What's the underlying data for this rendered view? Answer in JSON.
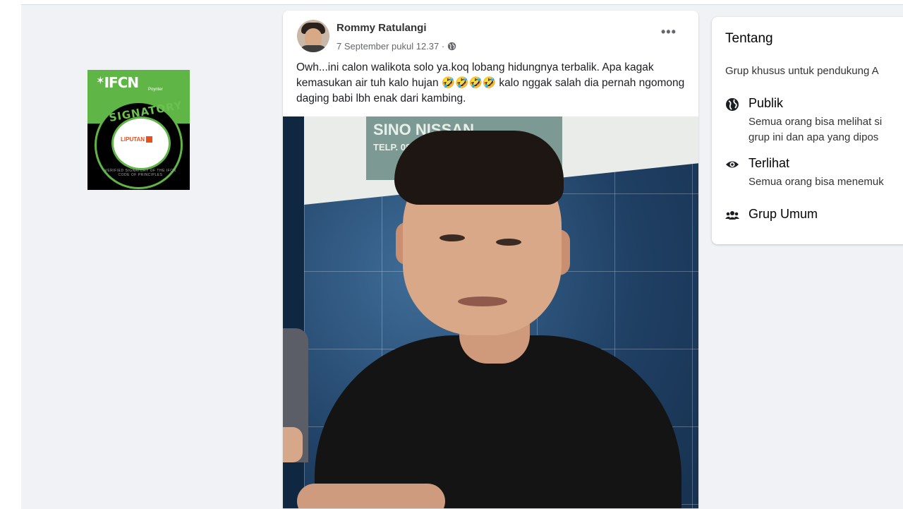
{
  "badge": {
    "logo": "IFCN",
    "logo_sub": "Poynter",
    "ring_text": "SIGNATORY",
    "ring_small": "VERIFIED SIGNATORY OF THE IFCN CODE OF PRINCIPLES",
    "publisher": "LIPUTAN"
  },
  "post": {
    "author": "Rommy Ratulangi",
    "timestamp": "7 September pukul 12.37 ·",
    "more_label": "•••",
    "text": "Owh...ini calon walikota solo ya.koq lobang hidungnya terbalik. Apa kagak kemasukan air tuh kalo hujan 🤣🤣🤣🤣 kalo nggak salah dia pernah ngomong daging babi lbh enak dari kambing.",
    "photo_sign": "SINO NISSAN",
    "photo_sign_phone": "TELP. 0851 2774 7088"
  },
  "about": {
    "title": "Tentang",
    "description": "Grup khusus untuk pendukung A",
    "items": [
      {
        "icon": "globe-icon",
        "title": "Publik",
        "desc_lines": [
          "Semua orang bisa melihat si",
          "grup ini dan apa yang dipos"
        ]
      },
      {
        "icon": "eye-icon",
        "title": "Terlihat",
        "desc_lines": [
          "Semua orang bisa menemuk"
        ]
      },
      {
        "icon": "group-icon",
        "title": "Grup Umum",
        "desc_lines": []
      }
    ]
  }
}
